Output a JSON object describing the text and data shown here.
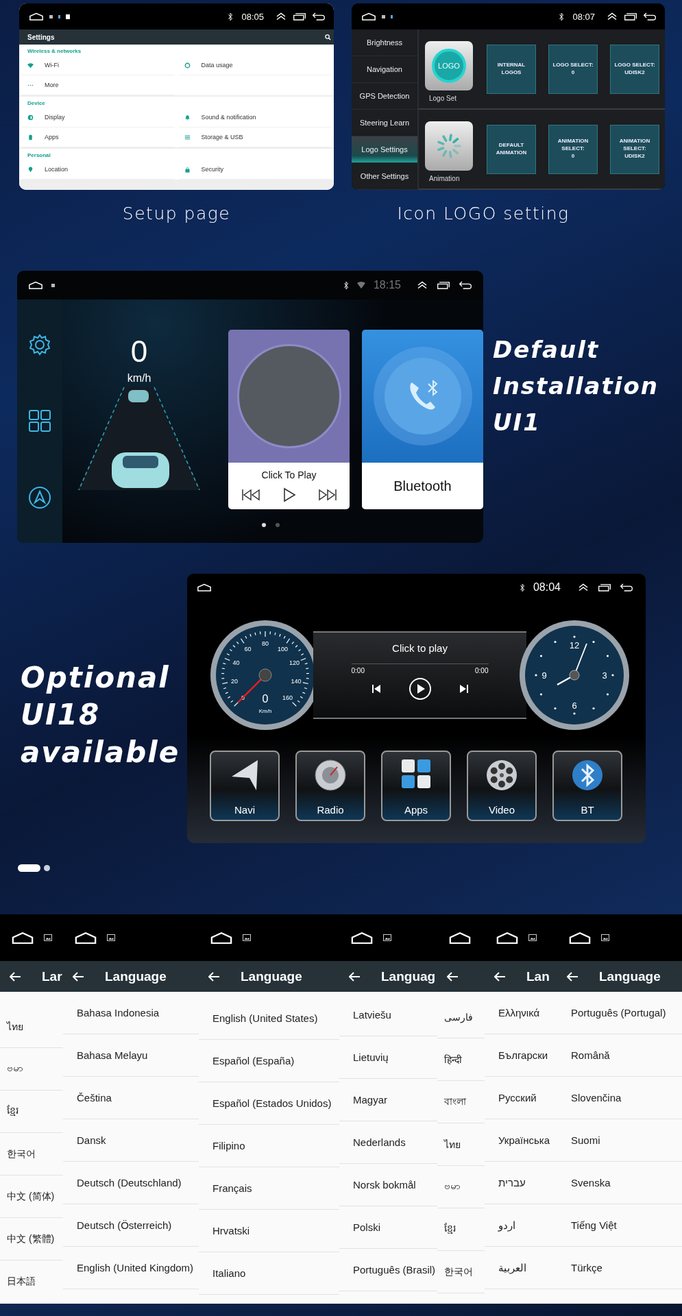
{
  "setup_screen": {
    "status_bar": {
      "time": "08:05"
    },
    "title": "Settings",
    "sections": [
      {
        "title": "Wireless & networks",
        "items": [
          {
            "label": "Wi-Fi"
          },
          {
            "label": "Data usage"
          },
          {
            "label": "More"
          }
        ]
      },
      {
        "title": "Device",
        "items": [
          {
            "label": "Display"
          },
          {
            "label": "Sound & notification"
          },
          {
            "label": "Apps"
          },
          {
            "label": "Storage & USB"
          }
        ]
      },
      {
        "title": "Personal",
        "items": [
          {
            "label": "Location"
          },
          {
            "label": "Security"
          }
        ]
      }
    ]
  },
  "logo_screen": {
    "status_bar": {
      "time": "08:07"
    },
    "menu": [
      {
        "label": "Brightness",
        "selected": false
      },
      {
        "label": "Navigation",
        "selected": false
      },
      {
        "label": "GPS Detection",
        "selected": false
      },
      {
        "label": "Steering Learn",
        "selected": false
      },
      {
        "label": "Logo Settings",
        "selected": true
      },
      {
        "label": "Other Settings",
        "selected": false
      }
    ],
    "groups": [
      {
        "kind": "logo",
        "label": "Logo Set",
        "icon_text": "LOGO",
        "options": [
          [
            "INTERNAL LOGOS"
          ],
          [
            "LOGO SELECT:",
            "0"
          ],
          [
            "LOGO SELECT:",
            "UDISK2"
          ]
        ]
      },
      {
        "kind": "animation",
        "label": "Animation",
        "options": [
          [
            "DEFAULT",
            "ANIMATION"
          ],
          [
            "ANIMATION",
            "SELECT:",
            "0"
          ],
          [
            "ANIMATION",
            "SELECT:",
            "UDISK2"
          ]
        ]
      }
    ]
  },
  "captions": [
    "Setup page",
    "Icon LOGO setting"
  ],
  "ui11_screen": {
    "status_bar": {
      "time": "18:15"
    },
    "speed": "0",
    "speed_unit": "km/h",
    "music_card": {
      "label": "Click To Play"
    },
    "bluetooth_card": {
      "label": "Bluetooth"
    },
    "pages": [
      {
        "selected": true
      },
      {
        "selected": false
      }
    ]
  },
  "ui11_caption": [
    "Default",
    "Installation",
    "UI1"
  ],
  "ui18_caption": [
    "Optional",
    "UI18",
    "available"
  ],
  "ui18_screen": {
    "status_bar": {
      "time": "08:04"
    },
    "speedometer": {
      "scale": [
        "0",
        "20",
        "40",
        "60",
        "80",
        "100",
        "120",
        "140",
        "160"
      ],
      "reading": "0",
      "unit": "Km/h"
    },
    "player": {
      "title": "Click to play",
      "elapsed": "0:00",
      "total": "0:00"
    },
    "clock": {
      "numerals": [
        "12",
        "3",
        "6",
        "9"
      ]
    },
    "apps": [
      {
        "kind": "navi",
        "label": "Navi"
      },
      {
        "kind": "radio",
        "label": "Radio"
      },
      {
        "kind": "apps",
        "label": "Apps"
      },
      {
        "kind": "video",
        "label": "Video"
      },
      {
        "kind": "bt",
        "label": "BT"
      }
    ]
  },
  "slides": [
    {
      "selected": true
    },
    {
      "selected": false
    }
  ],
  "language_screens": [
    {
      "title": "Lar",
      "items": [
        "ไทย",
        "ဗမာ",
        "ខ្មែរ",
        "한국어",
        "中文 (简体)",
        "中文 (繁體)",
        "日本語"
      ]
    },
    {
      "title": "Language",
      "items": [
        "Bahasa Indonesia",
        "Bahasa Melayu",
        "Čeština",
        "Dansk",
        "Deutsch (Deutschland)",
        "Deutsch (Österreich)",
        "English (United Kingdom)"
      ]
    },
    {
      "title": "Language",
      "items": [
        "English (United States)",
        "Español (España)",
        "Español (Estados Unidos)",
        "Filipino",
        "Français",
        "Hrvatski",
        "Italiano"
      ]
    },
    {
      "title": "Languag",
      "items": [
        "Latviešu",
        "Lietuvių",
        "Magyar",
        "Nederlands",
        "Norsk bokmål",
        "Polski",
        "Português (Brasil)"
      ]
    },
    {
      "items": [
        "فارسی",
        "हिन्दी",
        "বাংলা",
        "ไทย",
        "ဗမာ",
        "ខ្មែរ",
        "한국어"
      ]
    },
    {
      "title": "Lan",
      "items": [
        "Ελληνικά",
        "Български",
        "Русский",
        "Українська",
        "עברית",
        "اردو",
        "العربية"
      ]
    },
    {
      "title": "Language",
      "items": [
        "Português (Portugal)",
        "Română",
        "Slovenčina",
        "Suomi",
        "Svenska",
        "Tiếng Việt",
        "Türkçe"
      ]
    }
  ]
}
